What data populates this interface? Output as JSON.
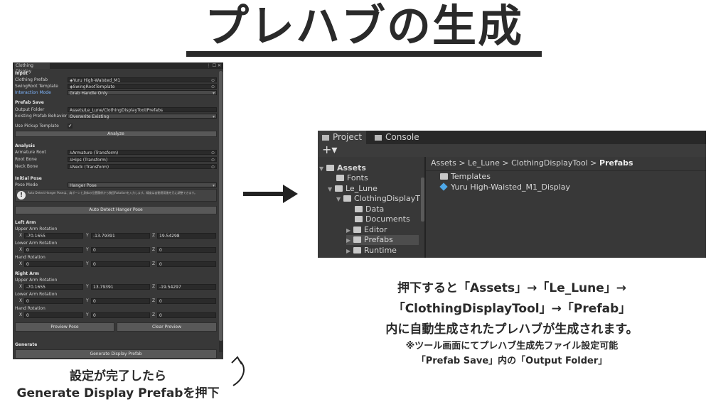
{
  "title": "プレハブの生成",
  "inspector": {
    "tab_label": "Clothing Display",
    "tab_controls": "⋮ ☐ ✕",
    "sections": {
      "input": "Input",
      "prefab_save": "Prefab Save",
      "analysis": "Analysis",
      "initial_pose": "Initial Pose",
      "left_arm": "Left Arm",
      "right_arm": "Right Arm",
      "generate": "Generate"
    },
    "fields": {
      "clothing_prefab_label": "Clothing Prefab",
      "clothing_prefab_value": "Yuru High-Waisted_M1",
      "swingroot_label": "SwingRoot Template",
      "swingroot_value": "SwingRootTemplate",
      "interaction_label": "Interaction Mode",
      "interaction_value": "Grab Handle Only",
      "output_folder_label": "Output Folder",
      "output_folder_value": "Assets/Le_Lune/ClothingDisplayTool/Prefabs",
      "existing_label": "Existing Prefab Behavior",
      "existing_value": "Overwrite Existing",
      "pickup_label": "Use Pickup Template",
      "pickup_check": "✔",
      "armature_label": "Armature Root",
      "armature_value": "Armature (Transform)",
      "rootbone_label": "Root Bone",
      "rootbone_value": "Hips (Transform)",
      "neckbone_label": "Neck Bone",
      "neckbone_value": "Neck (Transform)",
      "posemode_label": "Pose Mode",
      "posemode_value": "Hanger Pose"
    },
    "help_text": "Auto Detect Hanger Poseは、肩ボーンと身体の位置関係から腕回Rotationを入力します。精度は自動適用後を元に調整できます。",
    "buttons": {
      "analyze": "Analyze",
      "auto_detect": "Auto Detect Hanger Pose",
      "preview_pose": "Preview Pose",
      "clear_preview": "Clear Preview",
      "generate_display": "Generate Display Prefab"
    },
    "left_arm": {
      "upper_label": "Upper Arm Rotation",
      "upper": [
        "-70.1655",
        "-13.79391",
        "19.54298"
      ],
      "lower_label": "Lower Arm Rotation",
      "lower": [
        "0",
        "0",
        "0"
      ],
      "hand_label": "Hand Rotation",
      "hand": [
        "0",
        "0",
        "0"
      ]
    },
    "right_arm": {
      "upper_label": "Upper Arm Rotation",
      "upper": [
        "-70.1655",
        "13.79391",
        "-19.54297"
      ],
      "lower_label": "Lower Arm Rotation",
      "lower": [
        "0",
        "0",
        "0"
      ],
      "hand_label": "Hand Rotation",
      "hand": [
        "0",
        "0",
        "0"
      ]
    },
    "axes": [
      "X",
      "Y",
      "Z"
    ]
  },
  "project": {
    "tabs": [
      "Project",
      "Console"
    ],
    "add_label": "+▾",
    "tree": [
      "Assets",
      "Fonts",
      "Le_Lune",
      "ClothingDisplayT",
      "Data",
      "Documents",
      "Editor",
      "Prefabs",
      "Runtime"
    ],
    "breadcrumb": [
      "Assets",
      "Le_Lune",
      "ClothingDisplayTool",
      "Prefabs"
    ],
    "breadcrumb_sep": ">",
    "contents": [
      "Templates",
      "Yuru High-Waisted_M1_Display"
    ]
  },
  "captions": {
    "bottom_left_1": "設定が完了したら",
    "bottom_left_2": "Generate Display Prefabを押下",
    "right_1": "押下すると「Assets」→「Le_Lune」→",
    "right_2": "「ClothingDisplayTool」→「Prefab」",
    "right_3": "内に自動生成されたプレハブが生成されます。",
    "right_4": "※ツール画面にてプレハブ生成先ファイル設定可能",
    "right_5": "「Prefab Save」内の「Output Folder」"
  },
  "colors": {
    "unity_bg": "#383838",
    "unity_header": "#282828",
    "title": "#2a2a2a",
    "accent_blue": "#4ea8e8"
  }
}
